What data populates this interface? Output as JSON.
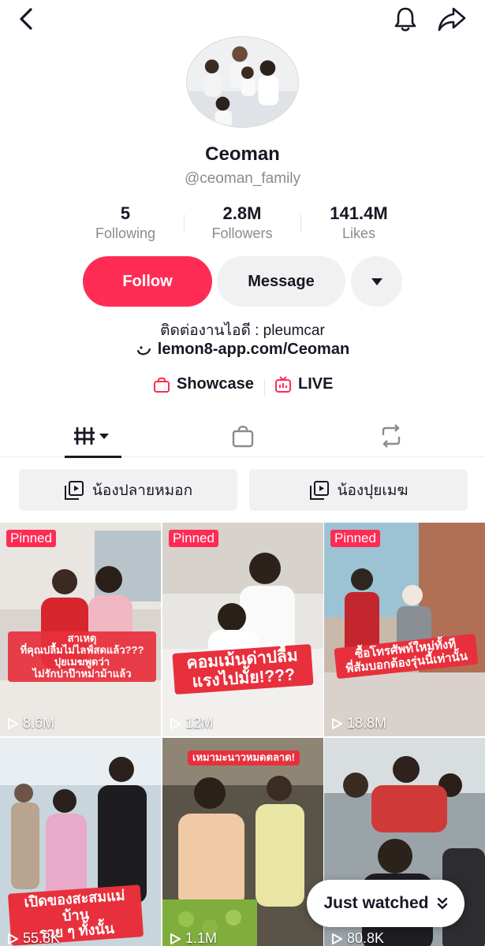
{
  "profile": {
    "name": "Ceoman",
    "handle": "@ceoman_family",
    "bio": "ติดต่องานไอดี : pleumcar",
    "link": "lemon8-app.com/Ceoman"
  },
  "stats": [
    {
      "value": "5",
      "label": "Following"
    },
    {
      "value": "2.8M",
      "label": "Followers"
    },
    {
      "value": "141.4M",
      "label": "Likes"
    }
  ],
  "actions": {
    "follow": "Follow",
    "message": "Message"
  },
  "pills": {
    "showcase": "Showcase",
    "live": "LIVE"
  },
  "playlists": [
    "น้องปลายหมอก",
    "น้องปุยเมฆ"
  ],
  "videos": [
    {
      "pinned": "Pinned",
      "caption": "สาเหตุ\nที่คุณปลื้มไม่ไลฟ์สดแล้ว???\nปุยเมฆพูดว่า\nไม่รักปาป๊าหม่าม้าแล้ว",
      "views": "8.6M"
    },
    {
      "pinned": "Pinned",
      "caption": "คอมเม้นด่าปลื้ม\nแรงไปมั้ย!???",
      "views": "12M"
    },
    {
      "pinned": "Pinned",
      "caption": "ซื้อโทรศัพท์ใหม่ทั้งที\nพี่สัมบอกต้องรุ่นนี้เท่านั้น",
      "views": "18.8M"
    },
    {
      "pinned": "",
      "caption": "เปิดของสะสมแม่บ้าน\nรวย ๆ ทั้งนั้น",
      "views": "55.8K"
    },
    {
      "pinned": "",
      "caption": "เหมามะนาวหมดตลาด!",
      "views": "1.1M"
    },
    {
      "pinned": "",
      "caption": "",
      "views": "80.8K"
    }
  ],
  "just_watched": "Just watched",
  "colors": {
    "accent": "#fe2c55",
    "caption_red": "#e8303d",
    "muted": "#8a8b91",
    "button_bg": "#f1f1f2"
  },
  "icons": [
    "back-icon",
    "bell-icon",
    "share-icon",
    "chevron-down-icon",
    "smile-link-icon",
    "bag-icon",
    "live-icon",
    "grid-icon",
    "bag-tab-icon",
    "repost-icon",
    "playlist-icon",
    "play-icon",
    "double-chevron-down-icon"
  ]
}
